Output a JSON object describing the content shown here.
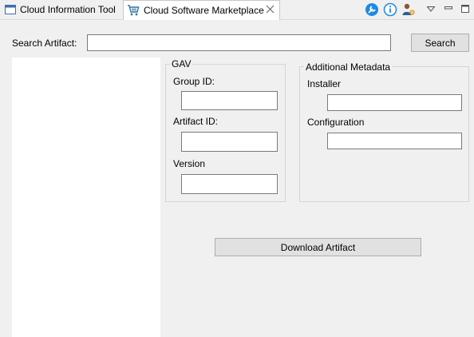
{
  "tabs": [
    {
      "label": "Cloud Information Tool",
      "icon": "window-icon",
      "active": false
    },
    {
      "label": "Cloud Software Marketplace",
      "icon": "cart-icon",
      "active": true
    }
  ],
  "toolbar": {
    "icons": [
      "wrench-icon",
      "info-icon",
      "user-settings-icon",
      "view-menu-icon",
      "minimize-icon",
      "maximize-icon"
    ]
  },
  "search": {
    "label": "Search Artifact:",
    "value": "",
    "button_label": "Search"
  },
  "results": [],
  "gav": {
    "title": "GAV",
    "group_id_label": "Group ID:",
    "group_id_value": "",
    "artifact_id_label": "Artifact ID:",
    "artifact_id_value": "",
    "version_label": "Version",
    "version_value": ""
  },
  "metadata": {
    "title": "Additional Metadata",
    "installer_label": "Installer",
    "installer_value": "",
    "configuration_label": "Configuration",
    "configuration_value": ""
  },
  "download": {
    "button_label": "Download Artifact"
  },
  "colors": {
    "background": "#f0f0f0",
    "accent_blue": "#1e88e5",
    "button_face": "#e1e1e1"
  }
}
